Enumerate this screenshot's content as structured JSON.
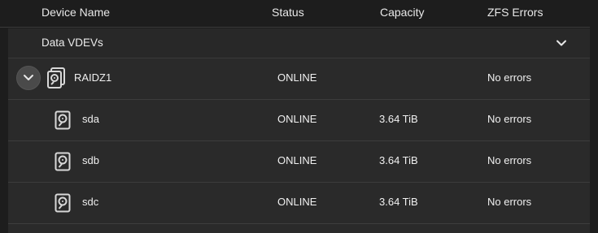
{
  "columns": {
    "device_name": "Device Name",
    "status": "Status",
    "capacity": "Capacity",
    "zfs_errors": "ZFS Errors"
  },
  "group": {
    "label": "Data VDEVs",
    "chevron_icon": "chevron-down-icon"
  },
  "vdev": {
    "name": "RAIDZ1",
    "status": "ONLINE",
    "capacity": "",
    "errors": "No errors",
    "icon": "raid-disk-icon"
  },
  "disks": [
    {
      "name": "sda",
      "status": "ONLINE",
      "capacity": "3.64 TiB",
      "errors": "No errors",
      "icon": "hard-disk-icon"
    },
    {
      "name": "sdb",
      "status": "ONLINE",
      "capacity": "3.64 TiB",
      "errors": "No errors",
      "icon": "hard-disk-icon"
    },
    {
      "name": "sdc",
      "status": "ONLINE",
      "capacity": "3.64 TiB",
      "errors": "No errors",
      "icon": "hard-disk-icon"
    }
  ],
  "colors": {
    "page_bg": "#1d1d1d",
    "panel_bg": "#2a2a2a",
    "text": "#f0f0f0",
    "divider": "#3d3d3d"
  }
}
